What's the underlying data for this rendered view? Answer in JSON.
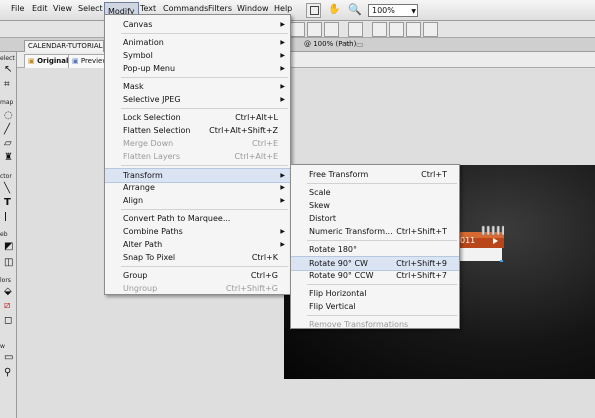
{
  "menubar": {
    "items": [
      "File",
      "Edit",
      "View",
      "Select",
      "Modify",
      "Text",
      "Commands",
      "Filters",
      "Window",
      "Help"
    ],
    "zoom": "100%"
  },
  "doc_tab": {
    "label": "CALENDAR-TUTORIAL.pn"
  },
  "view_tabs": {
    "original": "Original",
    "preview": "Preview"
  },
  "doc_info": "@ 100% (Path)",
  "tool_labels": {
    "select": "elect",
    "bitmap": "map",
    "vector": "ctor",
    "web": "eb",
    "colors": "lors",
    "view": "w"
  },
  "calendar": {
    "year_fragment": "011"
  },
  "modify_menu": [
    {
      "label": "Canvas",
      "arrow": true
    },
    {
      "sep": true
    },
    {
      "label": "Animation",
      "arrow": true
    },
    {
      "label": "Symbol",
      "arrow": true
    },
    {
      "label": "Pop-up Menu",
      "arrow": true
    },
    {
      "sep": true
    },
    {
      "label": "Mask",
      "arrow": true
    },
    {
      "label": "Selective JPEG",
      "arrow": true
    },
    {
      "sep": true
    },
    {
      "label": "Lock Selection",
      "shortcut": "Ctrl+Alt+L"
    },
    {
      "label": "Flatten Selection",
      "shortcut": "Ctrl+Alt+Shift+Z"
    },
    {
      "label": "Merge Down",
      "shortcut": "Ctrl+E",
      "disabled": true
    },
    {
      "label": "Flatten Layers",
      "shortcut": "Ctrl+Alt+E",
      "disabled": true
    },
    {
      "sep": true
    },
    {
      "label": "Transform",
      "arrow": true,
      "highlight": true
    },
    {
      "label": "Arrange",
      "arrow": true
    },
    {
      "label": "Align",
      "arrow": true
    },
    {
      "sep": true
    },
    {
      "label": "Convert Path to Marquee..."
    },
    {
      "label": "Combine Paths",
      "arrow": true
    },
    {
      "label": "Alter Path",
      "arrow": true
    },
    {
      "label": "Snap To Pixel",
      "shortcut": "Ctrl+K"
    },
    {
      "sep": true
    },
    {
      "label": "Group",
      "shortcut": "Ctrl+G"
    },
    {
      "label": "Ungroup",
      "shortcut": "Ctrl+Shift+G",
      "disabled": true
    }
  ],
  "transform_menu": [
    {
      "label": "Free Transform",
      "shortcut": "Ctrl+T"
    },
    {
      "sep": true
    },
    {
      "label": "Scale"
    },
    {
      "label": "Skew"
    },
    {
      "label": "Distort"
    },
    {
      "label": "Numeric Transform...",
      "shortcut": "Ctrl+Shift+T"
    },
    {
      "sep": true
    },
    {
      "label": "Rotate 180°"
    },
    {
      "label": "Rotate 90° CW",
      "shortcut": "Ctrl+Shift+9",
      "highlight": true
    },
    {
      "label": "Rotate 90° CCW",
      "shortcut": "Ctrl+Shift+7"
    },
    {
      "sep": true
    },
    {
      "label": "Flip Horizontal"
    },
    {
      "label": "Flip Vertical"
    },
    {
      "sep": true
    },
    {
      "label": "Remove Transformations",
      "disabled": true
    }
  ]
}
